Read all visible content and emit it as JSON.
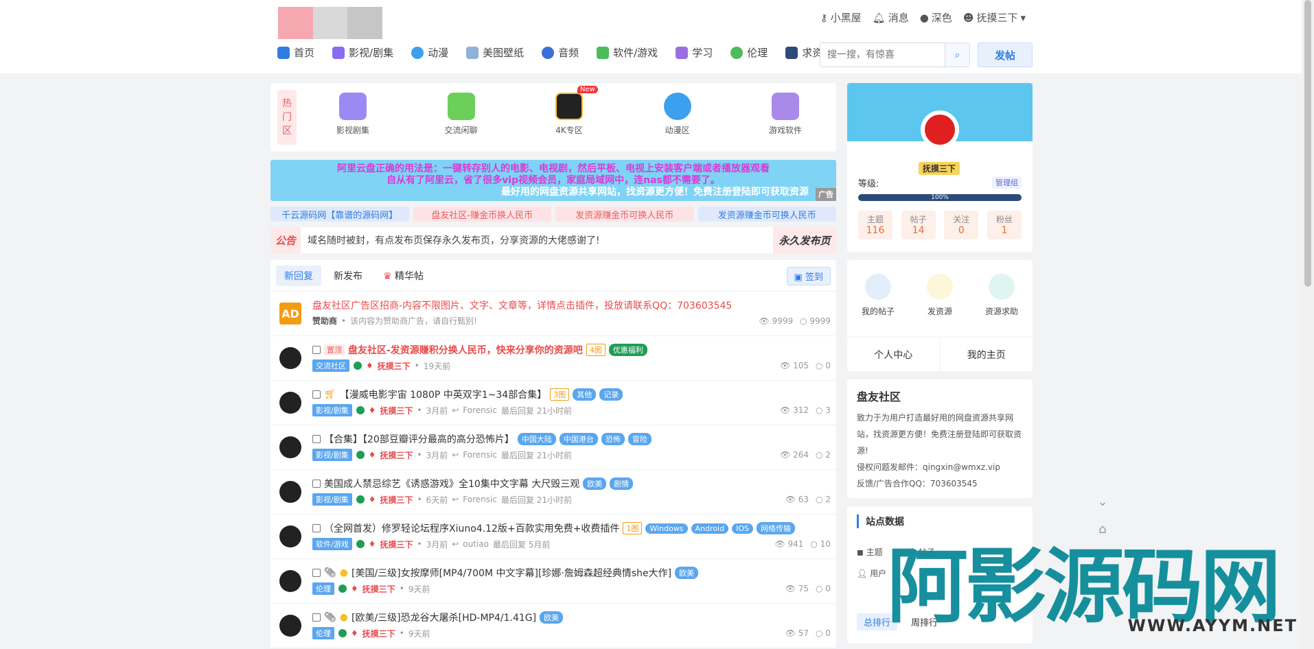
{
  "header": {
    "user_links": [
      "小黑屋",
      "消息",
      "深色",
      "抚摸三下"
    ],
    "nav": [
      "首页",
      "影视/剧集",
      "动漫",
      "美图壁纸",
      "音频",
      "软件/游戏",
      "学习",
      "伦理",
      "求资源"
    ],
    "search_placeholder": "搜一搜，有惊喜",
    "post_label": "发帖"
  },
  "hot": {
    "label": "热门区",
    "items": [
      "影视剧集",
      "交流闲聊",
      "4K专区",
      "动漫区",
      "游戏软件"
    ],
    "new_badge": "New"
  },
  "ad": {
    "line1": "阿里云盘正确的用法是：一键转存别人的电影、电视剧，然后平板、电视上安装客户端或者播放器观看",
    "line2": "自从有了阿里云，省了很多vip视频会员，家庭局域网中，连nas都不需要了。",
    "line3": "最好用的网盘资源共享网站，找资源更方便！免费注册登陆即可获取资源",
    "tag": "广告"
  },
  "links": [
    "千云源码网【靠谱的源码网】",
    "盘友社区-赚金币换人民币",
    "发资源赚金币可换人民币",
    "发资源赚金币可换人民币"
  ],
  "notice": {
    "label": "公告",
    "text": "域名随时被封，有点发布页保存永久发布页，分享资源的大佬感谢了!",
    "button": "永久发布页"
  },
  "tabs": [
    "新回复",
    "新发布",
    "精华帖"
  ],
  "sign": "签到",
  "rows": [
    {
      "title": "盘友社区广告区招商-内容不限图片、文字、文章等，详情点击插件，投放请联系QQ：703603545",
      "meta1": "赞助商",
      "meta2": "该内容为赞助商广告，请自行甄别!",
      "views": "9999",
      "replies": "9999"
    },
    {
      "top": "置顶",
      "title": "盘友社区-发资源赚积分换人民币，快来分享你的资源吧",
      "pics": "4图",
      "tags": [
        "优惠福利"
      ],
      "cat": "交流社区",
      "author": "抚摸三下",
      "time": "19天前",
      "views": "105",
      "replies": "0"
    },
    {
      "title": "【漫威电影宇宙 1080P 中英双字1~34部合集】",
      "pics": "3图",
      "tags": [
        "其他",
        "记录"
      ],
      "cat": "影视/剧集",
      "author": "抚摸三下",
      "time": "3月前",
      "last": "Forensic",
      "lasttime": "最后回复 21小时前",
      "views": "312",
      "replies": "3"
    },
    {
      "title": "【合集】【20部豆瓣评分最高的高分恐怖片】",
      "tags": [
        "中国大陆",
        "中国港台",
        "恐怖",
        "冒险"
      ],
      "cat": "影视/剧集",
      "author": "抚摸三下",
      "time": "3月前",
      "last": "Forensic",
      "lasttime": "最后回复 21小时前",
      "views": "264",
      "replies": "2"
    },
    {
      "title": "美国成人禁忌综艺《诱惑游戏》全10集中文字幕 大尺毁三观",
      "tags": [
        "欧美",
        "剧情"
      ],
      "cat": "影视/剧集",
      "author": "抚摸三下",
      "time": "6天前",
      "last": "Forensic",
      "lasttime": "最后回复 21小时前",
      "views": "63",
      "replies": "2"
    },
    {
      "title": "（全网首发）修罗轻论坛程序Xiuno4.12版+百款实用免费+收费插件",
      "pics": "1图",
      "tags": [
        "Windows",
        "Android",
        "IOS",
        "网络传输"
      ],
      "cat": "软件/游戏",
      "author": "抚摸三下",
      "time": "3月前",
      "last": "outiao",
      "lasttime": "最后回复 5月前",
      "views": "941",
      "replies": "10"
    },
    {
      "title": "[美国/三级]女按摩师[MP4/700M 中文字幕][珍娜·詹姆森超经典情she大作]",
      "tags": [
        "欧美"
      ],
      "cat": "伦理",
      "author": "抚摸三下",
      "time": "9天前",
      "views": "75",
      "replies": "0"
    },
    {
      "title": "[欧美/三级]恐龙谷大屠杀[HD-MP4/1.41G]",
      "tags": [
        "欧美"
      ],
      "cat": "伦理",
      "author": "抚摸三下",
      "time": "9天前",
      "views": "57",
      "replies": "0"
    }
  ],
  "profile": {
    "name": "抚摸三下",
    "level_label": "等级:",
    "group": "管理组",
    "progress": "100%",
    "progress_value": 100,
    "stats": [
      {
        "label": "主题",
        "value": "116"
      },
      {
        "label": "帖子",
        "value": "14"
      },
      {
        "label": "关注",
        "value": "0"
      },
      {
        "label": "粉丝",
        "value": "1"
      }
    ]
  },
  "quick": {
    "items": [
      "我的帖子",
      "发资源",
      "资源求助"
    ],
    "links": [
      "个人中心",
      "我的主页"
    ]
  },
  "info": {
    "title": "盘友社区",
    "desc": "致力于为用户打造最好用的网盘资源共享网站，找资源更方便！免费注册登陆即可获取资源!",
    "email": "侵权问题发邮件：qingxin@wmxz.vip",
    "qq": "反馈/广告合作QQ：703603545"
  },
  "site": {
    "title": "站点数据",
    "row1a": "主题",
    "row1b": "帖子",
    "row2a": "用户",
    "tab1": "总排行",
    "tab2": "周排行"
  },
  "watermark": {
    "big": "阿影源码网",
    "url": "WWW.AYYM.NET"
  },
  "colors": {
    "accent": "#2f7de1",
    "red": "#e84b4b"
  }
}
